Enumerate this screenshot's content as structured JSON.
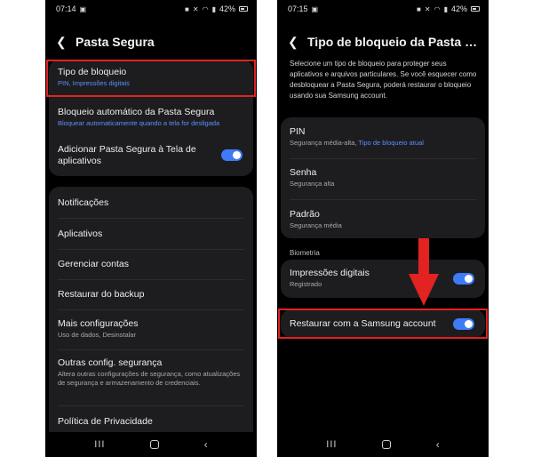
{
  "left": {
    "status": {
      "time": "07:14",
      "battery": "42%"
    },
    "header": {
      "title": "Pasta Segura",
      "back_icon": "chevron-left-icon"
    },
    "group1": [
      {
        "title": "Tipo de bloqueio",
        "subtitle": "PIN, Impressões digitais",
        "subtitle_color": "blue"
      },
      {
        "title": "Bloqueio automático da Pasta Segura",
        "subtitle": "Bloquear automaticamente quando a tela for desligada",
        "subtitle_color": "blue"
      },
      {
        "title": "Adicionar Pasta Segura à Tela de aplicativos",
        "toggle": "on"
      }
    ],
    "group2": [
      {
        "title": "Notificações"
      },
      {
        "title": "Aplicativos"
      },
      {
        "title": "Gerenciar contas"
      },
      {
        "title": "Restaurar do backup"
      },
      {
        "title": "Mais configurações",
        "subtitle": "Uso de dados, Desinstalar"
      },
      {
        "title": "Outras config. segurança",
        "subtitle": "Altera outras configurações de segurança, como atualizações de segurança e armazenamento de credenciais."
      },
      {
        "title": "Política de Privacidade"
      }
    ]
  },
  "right": {
    "status": {
      "time": "07:15",
      "battery": "42%"
    },
    "header": {
      "title": "Tipo de bloqueio da Pasta Se…",
      "back_icon": "chevron-left-icon"
    },
    "description": "Selecione um tipo de bloqueio para proteger seus aplicativos e arquivos particulares. Se você esquecer como desbloquear a Pasta Segura, poderá restaurar o bloqueio usando sua Samsung account.",
    "lock_types": [
      {
        "title": "PIN",
        "subtitle": "Segurança média-alta, ",
        "subtitle_extra": "Tipo de bloqueio atual"
      },
      {
        "title": "Senha",
        "subtitle": "Segurança alta"
      },
      {
        "title": "Padrão",
        "subtitle": "Segurança média"
      }
    ],
    "biometrics_label": "Biometria",
    "fingerprint": {
      "title": "Impressões digitais",
      "subtitle": "Registrado",
      "toggle": "on"
    },
    "restore": {
      "title": "Restaurar com a Samsung account",
      "toggle": "on"
    }
  },
  "navbar": {
    "recent": "III",
    "home": "home-icon",
    "back": "‹"
  },
  "colors": {
    "highlight": "#e32222",
    "accent": "#3e7bf6",
    "link": "#5c8fff",
    "card": "#1d1d1f",
    "background": "#000000"
  }
}
